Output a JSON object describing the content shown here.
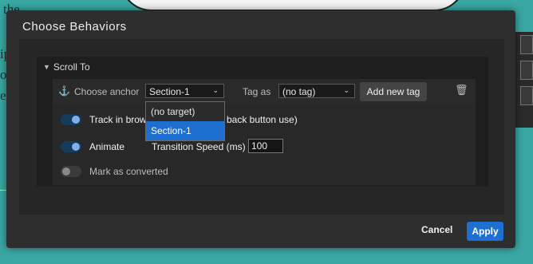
{
  "background": {
    "fragments": [
      "the",
      "ip",
      "on",
      "es"
    ]
  },
  "dialog": {
    "title": "Choose Behaviors",
    "section": {
      "label": "Scroll To"
    },
    "anchor": {
      "label": "Choose anchor",
      "selected": "Section-1",
      "options": [
        "(no target)",
        "Section-1"
      ]
    },
    "tag": {
      "label": "Tag as",
      "selected": "(no tag)"
    },
    "add_tag_label": "Add new tag",
    "track": {
      "label_start": "Track in brow",
      "label_end": "back button use)",
      "on": true
    },
    "animate": {
      "label": "Animate",
      "on": true
    },
    "transition": {
      "label": "Transition Speed (ms)",
      "value": "100"
    },
    "converted": {
      "label": "Mark as converted",
      "on": false
    },
    "cancel_label": "Cancel",
    "apply_label": "Apply"
  },
  "colors": {
    "accent": "#1f6fd0",
    "page_background": "#3aa7a3",
    "dialog_background": "#2e2e2e"
  },
  "icons": [
    "anchor-icon",
    "trash-icon",
    "caret-down-icon",
    "chevron-down-icon"
  ]
}
